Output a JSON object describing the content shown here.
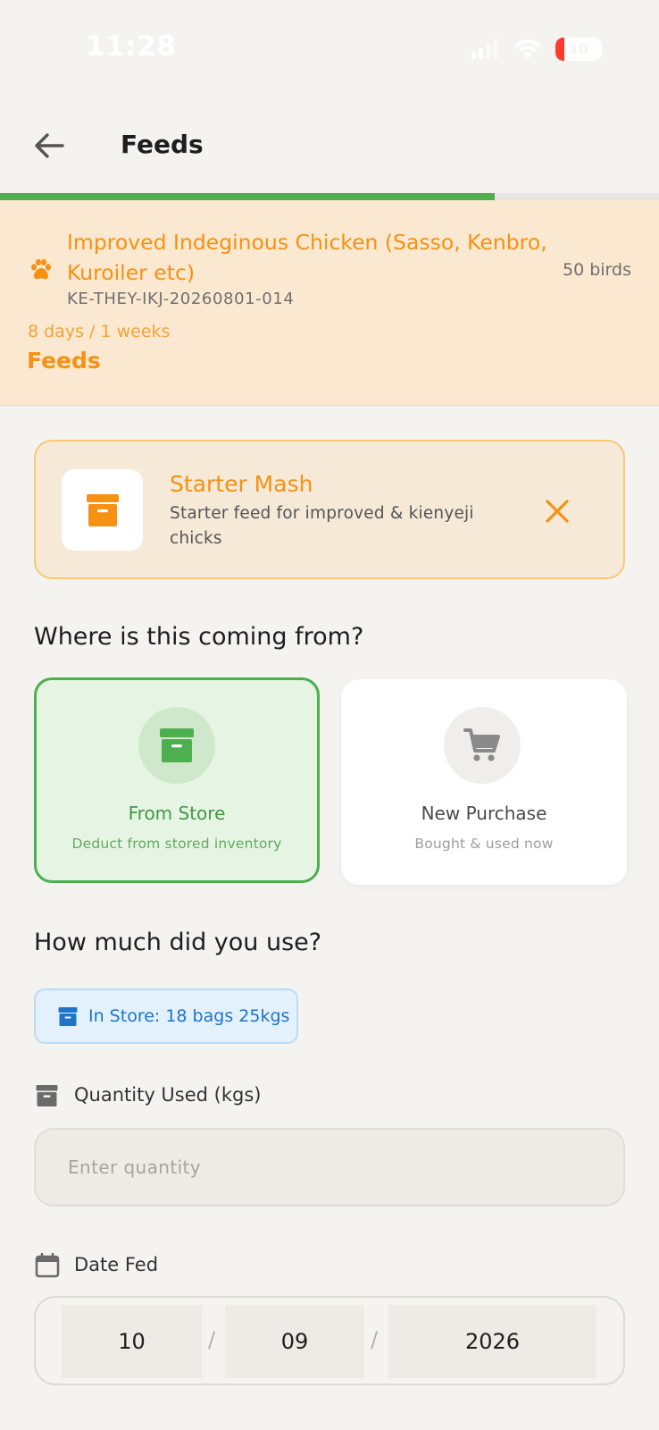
{
  "status_bar": {
    "time": "11:28",
    "battery": "10",
    "colors": {
      "battery_low": "#ff3b30"
    }
  },
  "header": {
    "title": "Feeds",
    "back_icon": "arrow-left-icon"
  },
  "progress": {
    "fraction": 0.75,
    "color": "#4caf50"
  },
  "batch": {
    "name": "Improved Indeginous Chicken (Sasso, Kenbro, Kuroiler etc)",
    "code": "KE-THEY-IKJ-20260801-014",
    "birds": "50 birds",
    "age": "8 days / 1 weeks",
    "section": "Feeds",
    "icon": "paw-icon",
    "accent": "#f59113"
  },
  "selected_feed": {
    "name": "Starter Mash",
    "description": "Starter feed for improved & kienyeji chicks",
    "icon": "archive-box-icon",
    "close_icon": "close-icon"
  },
  "source": {
    "question": "Where is this coming from?",
    "options": [
      {
        "title": "From Store",
        "subtitle": "Deduct from stored inventory",
        "icon": "archive-box-icon",
        "selected": true
      },
      {
        "title": "New Purchase",
        "subtitle": "Bought & used now",
        "icon": "shopping-cart-icon",
        "selected": false
      }
    ]
  },
  "usage": {
    "question": "How much did you use?",
    "in_store": "In Store: 18 bags 25kgs",
    "quantity_label": "Quantity Used (kgs)",
    "quantity_value": "",
    "quantity_placeholder": "Enter quantity",
    "date_label": "Date Fed",
    "date": {
      "day": "10",
      "month": "09",
      "year": "2026",
      "separator": "/"
    }
  }
}
